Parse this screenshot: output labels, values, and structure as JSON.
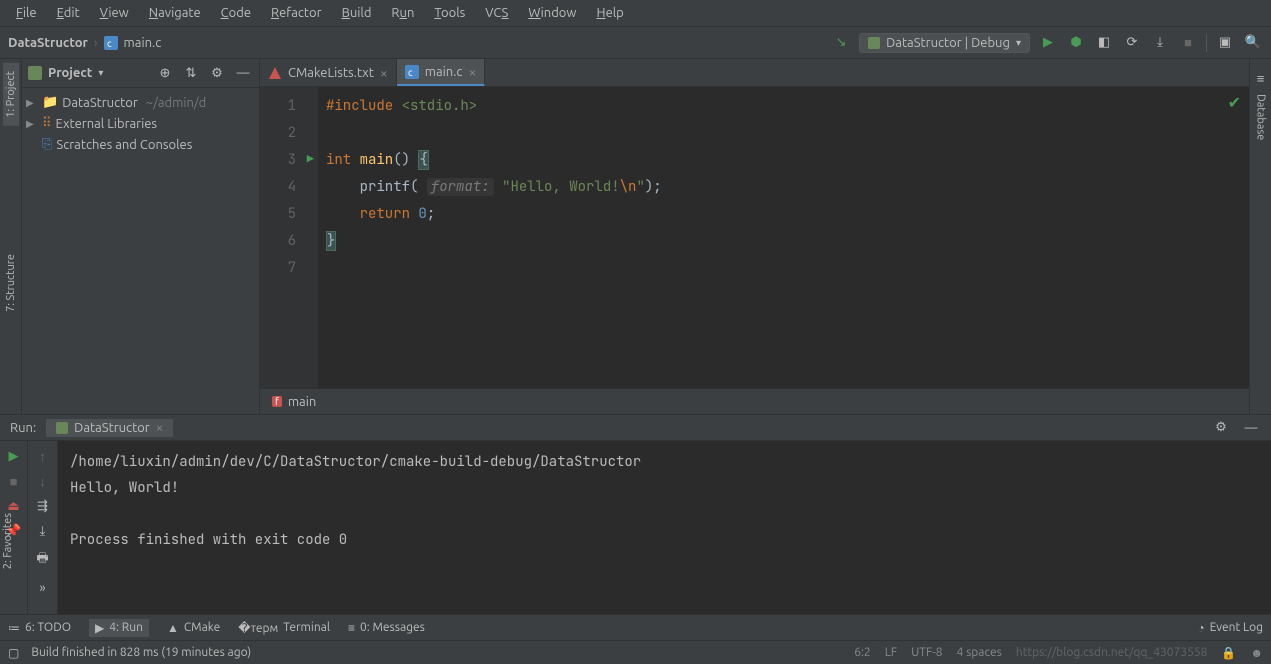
{
  "menu": [
    "File",
    "Edit",
    "View",
    "Navigate",
    "Code",
    "Refactor",
    "Build",
    "Run",
    "Tools",
    "VCS",
    "Window",
    "Help"
  ],
  "breadcrumb": {
    "project": "DataStructor",
    "file": "main.c"
  },
  "run_config": "DataStructor | Debug",
  "project_panel": {
    "title": "Project",
    "items": [
      {
        "label": "DataStructor",
        "hint": "~/admin/d",
        "icon": "folder"
      },
      {
        "label": "External Libraries",
        "icon": "lib"
      },
      {
        "label": "Scratches and Consoles",
        "icon": "scratch"
      }
    ]
  },
  "left_tabs": [
    "1: Project",
    "7: Structure"
  ],
  "left_tabs2": [
    "2: Favorites"
  ],
  "right_tabs": [
    "Database"
  ],
  "editor_tabs": [
    {
      "label": "CMakeLists.txt",
      "active": false
    },
    {
      "label": "main.c",
      "active": true
    }
  ],
  "code": {
    "line1_include": "#include",
    "line1_header": "<stdio.h>",
    "line3_int": "int",
    "line3_main": "main",
    "line3_rest": "() ",
    "line4_printf": "printf",
    "line4_hint": "format:",
    "line4_str1": "\"Hello, World!",
    "line4_esc": "\\n",
    "line4_str2": "\"",
    "line5_return": "return",
    "line5_zero": "0",
    "line_numbers": [
      "1",
      "2",
      "3",
      "4",
      "5",
      "6",
      "7"
    ]
  },
  "crumb": "main",
  "run": {
    "label": "Run:",
    "tab": "DataStructor",
    "output": [
      "/home/liuxin/admin/dev/C/DataStructor/cmake-build-debug/DataStructor",
      "Hello, World!",
      "",
      "Process finished with exit code 0"
    ]
  },
  "bottom": {
    "todo": "6: TODO",
    "run": "4: Run",
    "cmake": "CMake",
    "terminal": "Terminal",
    "messages": "0: Messages",
    "eventlog": "Event Log"
  },
  "status": {
    "build": "Build finished in 828 ms (19 minutes ago)",
    "pos": "6:2",
    "le": "LF",
    "enc": "UTF-8",
    "indent": "4 spaces",
    "watermark": "https://blog.csdn.net/qq_43073558"
  }
}
